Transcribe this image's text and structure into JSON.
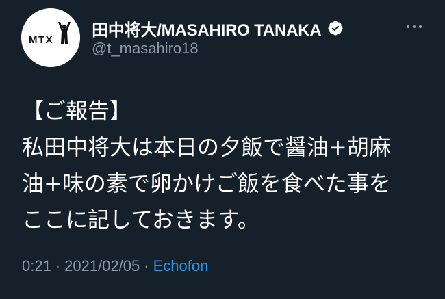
{
  "author": {
    "display_name": "田中将大/MASAHIRO TANAKA",
    "handle": "@t_masahiro18",
    "avatar_text": "MTX",
    "verified": true
  },
  "tweet": {
    "lines": [
      "【ご報告】",
      "私田中将大は本日の夕飯で醤油+胡麻",
      "油+味の素で卵かけご飯を食べた事を",
      "ここに記しておきます。"
    ]
  },
  "meta": {
    "time": "0:21",
    "separator": "·",
    "date": "2021/02/05",
    "source": "Echofon"
  },
  "icons": {
    "verified": "verified-badge-icon",
    "more": "more-options-icon"
  },
  "colors": {
    "background": "#15202b",
    "primary_text": "#ffffff",
    "secondary_text": "#8b98a5",
    "link": "#1d9bf0"
  }
}
